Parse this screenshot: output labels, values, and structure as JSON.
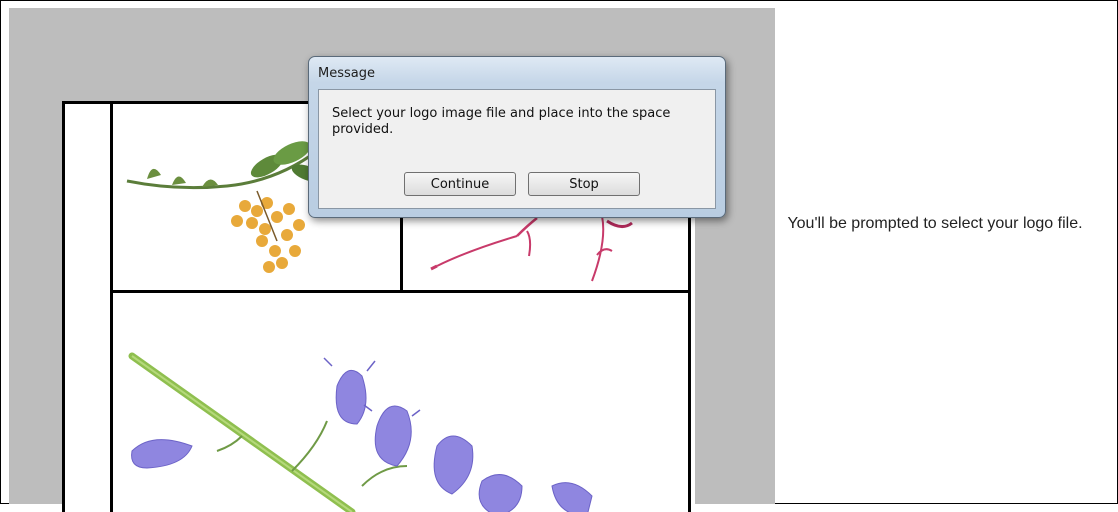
{
  "dialog": {
    "title": "Message",
    "message": "Select your logo image file and place into the space provided.",
    "buttons": {
      "continue": "Continue",
      "stop": "Stop"
    }
  },
  "caption": "You'll be prompted to select your logo file.",
  "colors": {
    "canvas_background": "#bdbdbd",
    "dialog_chrome": "#c5d6e8",
    "dialog_body": "#f0f0f0"
  },
  "images": [
    {
      "name": "berries-flower-icon"
    },
    {
      "name": "pink-flower-icon"
    },
    {
      "name": "bluebell-flower-icon"
    }
  ]
}
